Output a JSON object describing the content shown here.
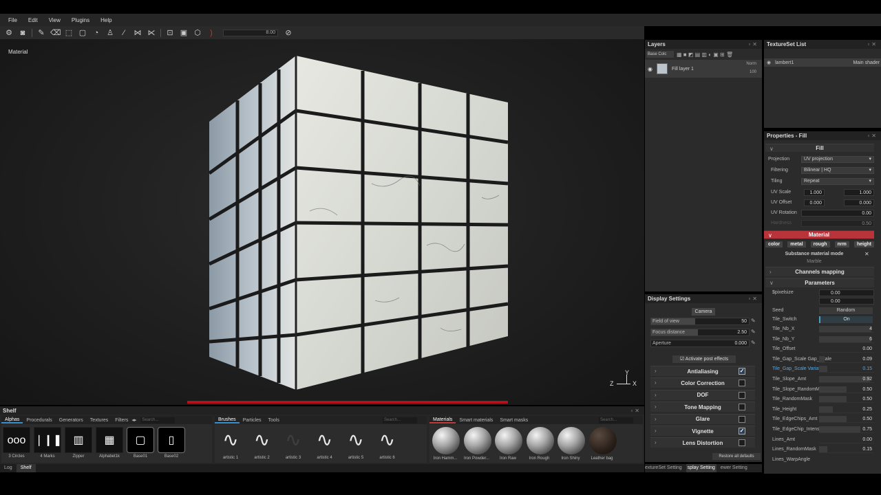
{
  "menu": [
    "File",
    "Edit",
    "View",
    "Plugins",
    "Help"
  ],
  "toolbar": {
    "value": "8.00"
  },
  "viewport": {
    "label": "Material"
  },
  "layers": {
    "title": "Layers",
    "channel_select": "Base Colc",
    "items": [
      {
        "name": "Fill layer 1",
        "blend": "Norm",
        "opacity": "100"
      }
    ]
  },
  "textureset": {
    "title": "TextureSet List",
    "items": [
      {
        "name": "lambert1",
        "shader": "Main shader"
      }
    ]
  },
  "display": {
    "title": "Display Settings",
    "camera_btn": "Camera",
    "params": [
      {
        "label": "Field of view",
        "value": "50",
        "fill": 0.45
      },
      {
        "label": "Focus distance",
        "value": "2.50",
        "fill": 0.48
      },
      {
        "label": "Aperture",
        "value": "0.000",
        "fill": 0.0
      }
    ],
    "post_effects": "Activate post effects",
    "effects": [
      {
        "label": "Antialiasing",
        "checked": true
      },
      {
        "label": "Color Correction",
        "checked": false
      },
      {
        "label": "DOF",
        "checked": false
      },
      {
        "label": "Tone Mapping",
        "checked": false
      },
      {
        "label": "Glare",
        "checked": false
      },
      {
        "label": "Vignette",
        "checked": true
      },
      {
        "label": "Lens Distortion",
        "checked": false
      }
    ],
    "restore": "Restore all defaults",
    "tabs": [
      "extureSet Setting",
      "splay Setting",
      "ewer Setting"
    ]
  },
  "properties": {
    "title": "Properties - Fill",
    "fill_header": "Fill",
    "projection_label": "Projection",
    "projection": "UV projection",
    "filtering_label": "Filtering",
    "filtering": "Bilinear | HQ",
    "tiling_label": "Tiling",
    "tiling": "Repeat",
    "uvscale_label": "UV Scale",
    "uvscale_a": "1.000",
    "uvscale_b": "1.000",
    "uvoffset_label": "UV Offset",
    "uvoffset_a": "0.000",
    "uvoffset_b": "0.000",
    "uvrot_label": "UV Rotation",
    "uvrot": "0.00",
    "hardness_label": "Hardness",
    "hardness": "0.50",
    "material_header": "Material",
    "channels": [
      "color",
      "metal",
      "rough",
      "nrm",
      "height"
    ],
    "mode_title": "Substance material mode",
    "mode_value": "Marble",
    "channels_mapping": "Channels mapping",
    "parameters": "Parameters",
    "pixelsize_label": "$pixelsize",
    "pixelsize_a": "0.00",
    "pixelsize_b": "0.00",
    "seed_label": "Seed",
    "seed_btn": "Random",
    "switch_label": "Tile_Switch",
    "switch_value": "On",
    "params": [
      {
        "label": "Tile_Nb_X",
        "value": "4",
        "fill": 0.95
      },
      {
        "label": "Tile_Nb_Y",
        "value": "6",
        "fill": 0.95
      },
      {
        "label": "Tile_Offset",
        "value": "0.00",
        "fill": 0.0
      },
      {
        "label": "Tile_Gap_Scale Gap_Scale",
        "value": "0.09",
        "fill": 0.1
      },
      {
        "label": "Tile_Gap_Scale Variation",
        "value": "0.15",
        "fill": 0.15
      },
      {
        "label": "Tile_Slope_Amt",
        "value": "0.92",
        "fill": 0.92
      },
      {
        "label": "Tile_Slope_RandomMask",
        "value": "0.50",
        "fill": 0.5
      },
      {
        "label": "Tile_RandomMask",
        "value": "0.50",
        "fill": 0.5
      },
      {
        "label": "Tile_Height",
        "value": "0.25",
        "fill": 0.25
      },
      {
        "label": "Tile_EdgeChips_Amt",
        "value": "0.50",
        "fill": 0.5
      },
      {
        "label": "Tile_EdgeChip_Intensity",
        "value": "0.75",
        "fill": 0.75
      },
      {
        "label": "Lines_Amt",
        "value": "0.00",
        "fill": 0.0
      },
      {
        "label": "Lines_RandomMask",
        "value": "0.15",
        "fill": 0.15
      },
      {
        "label": "Lines_WarpAngle",
        "value": "",
        "fill": 0.0
      }
    ]
  },
  "shelf": {
    "title": "Shelf",
    "tabs1": [
      "Alphas",
      "Procedurals",
      "Generators",
      "Textures",
      "Filters"
    ],
    "search": "Search...",
    "alphas": [
      "3 Circles",
      "4 Marks",
      "Zipper",
      "Alphabet1k",
      "Base01",
      "Base02"
    ],
    "tabs2": [
      "Brushes",
      "Particles",
      "Tools"
    ],
    "brushes": [
      "artistic 1",
      "artistic 2",
      "artistic 3",
      "artistic 4",
      "artistic 5",
      "artistic 6"
    ],
    "tabs3": [
      "Materials",
      "Smart materials",
      "Smart masks"
    ],
    "materials": [
      "Iron Hamm...",
      "Iron Powder...",
      "Iron Raw",
      "Iron Rough",
      "Iron Shiny",
      "Leather bag"
    ],
    "bottom_tabs": [
      "Log",
      "Shelf"
    ]
  },
  "axis": {
    "z": "Z",
    "y": "Y",
    "x": "X"
  }
}
